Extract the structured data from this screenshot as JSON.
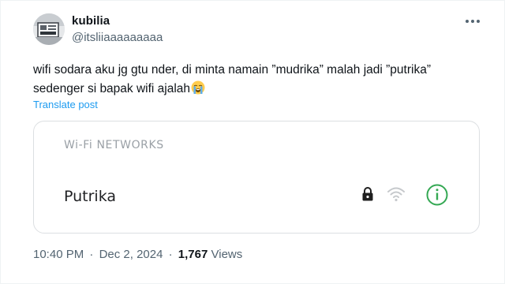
{
  "author": {
    "display_name": "kubilia",
    "handle": "@itsliiaaaaaaaaa",
    "avatar_icon": "user-avatar"
  },
  "post": {
    "text": "wifi sodara aku jg gtu nder, di minta namain ”mudrika” malah jadi ”putrika” sedenger si bapak wifi ajalah",
    "emoji_icon": "loudly-crying-face-icon",
    "translate_label": "Translate post"
  },
  "card": {
    "header": "Wi-Fi NETWORKS",
    "network_name": "Putrika",
    "icons": [
      "lock-icon",
      "wifi-icon",
      "info-icon"
    ],
    "accent_color": "#34a853"
  },
  "meta": {
    "time": "10:40 PM",
    "separator": "·",
    "date": "Dec 2, 2024",
    "views_count": "1,767",
    "views_label": "Views"
  },
  "colors": {
    "text": "#0f1419",
    "secondary": "#536471",
    "link": "#1d9bf0"
  }
}
